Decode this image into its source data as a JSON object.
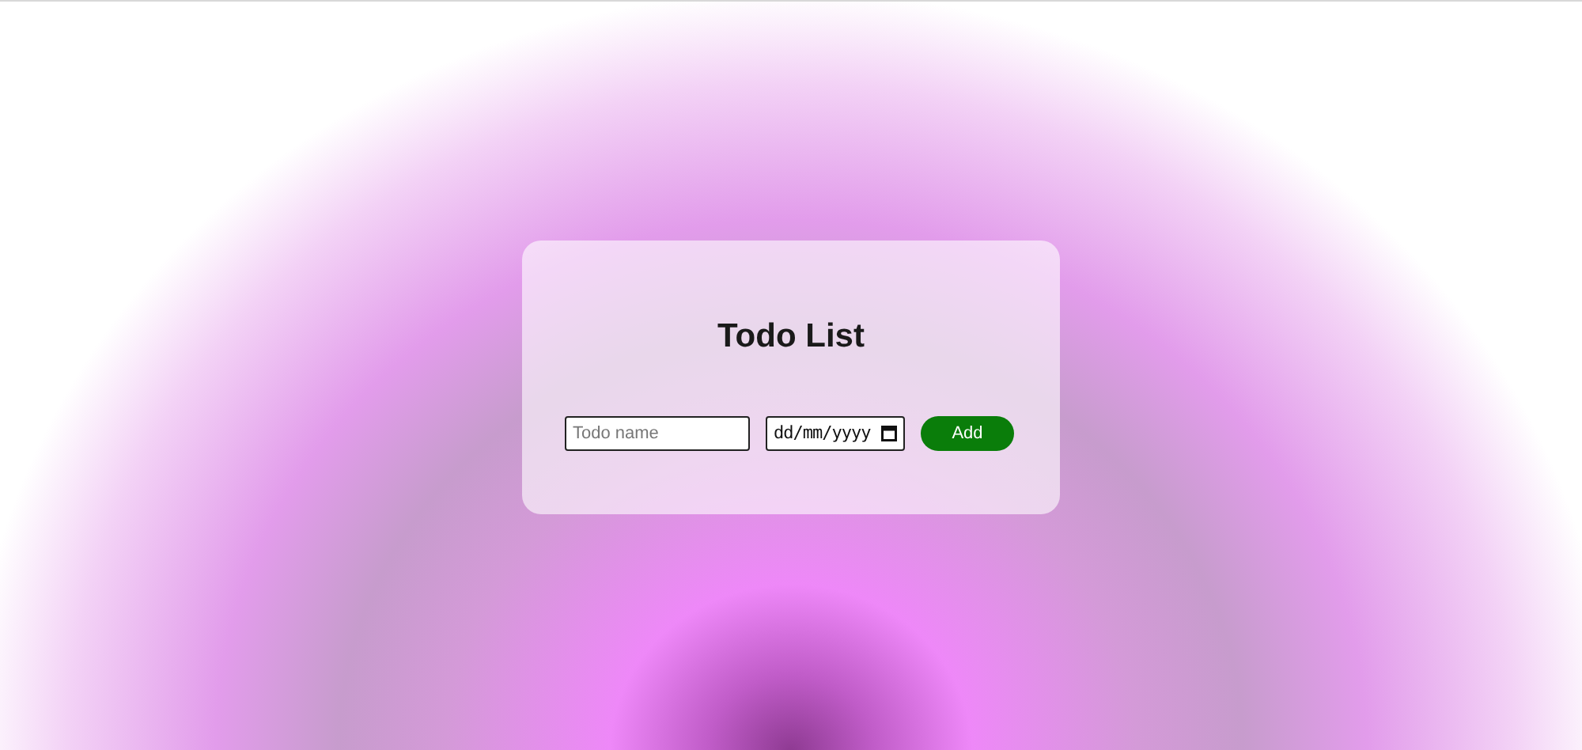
{
  "title": "Todo List",
  "todo_field": {
    "placeholder": "Todo name"
  },
  "date_field": {
    "placeholder": "dd/mm/yyyy"
  },
  "add_button": {
    "label": "Add"
  }
}
